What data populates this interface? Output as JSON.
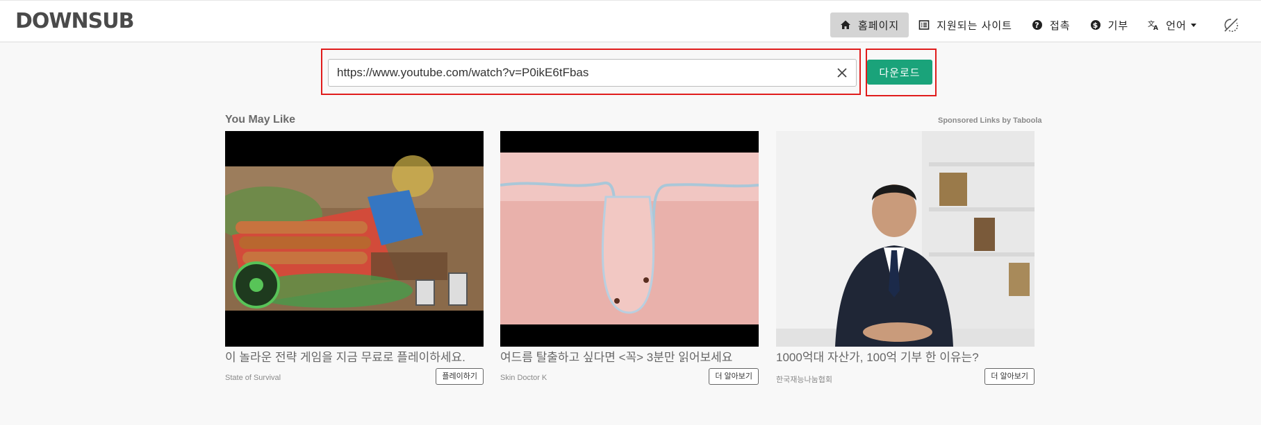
{
  "header": {
    "logo_text": "DOWNSUB",
    "nav": [
      {
        "label": "홈페이지",
        "icon": "home-icon",
        "active": true
      },
      {
        "label": "지원되는 사이트",
        "icon": "list-icon"
      },
      {
        "label": "접촉",
        "icon": "question-icon"
      },
      {
        "label": "기부",
        "icon": "dollar-icon"
      },
      {
        "label": "언어",
        "icon": "translate-icon"
      }
    ],
    "theme_icon": "theme-toggle-icon"
  },
  "search": {
    "value": "https://www.youtube.com/watch?v=P0ikE6tFbas",
    "download_label": "다운로드"
  },
  "feed": {
    "title": "You May Like",
    "sponsor": "Sponsored Links by Taboola",
    "cards": [
      {
        "title": "이 놀라운 전략 게임을 지금 무료로 플레이하세요.",
        "source": "State of Survival",
        "cta": "플레이하기"
      },
      {
        "title": "여드름 탈출하고 싶다면 <꼭> 3분만 읽어보세요",
        "source": "Skin Doctor K",
        "cta": "더 알아보기"
      },
      {
        "title": "1000억대 자산가, 100억 기부 한 이유는?",
        "source": "한국재능나눔협회",
        "cta": "더 알아보기"
      }
    ]
  },
  "colors": {
    "accent": "#1aa37a",
    "highlight": "#e01b1b",
    "active_nav": "#d4d4d4"
  }
}
